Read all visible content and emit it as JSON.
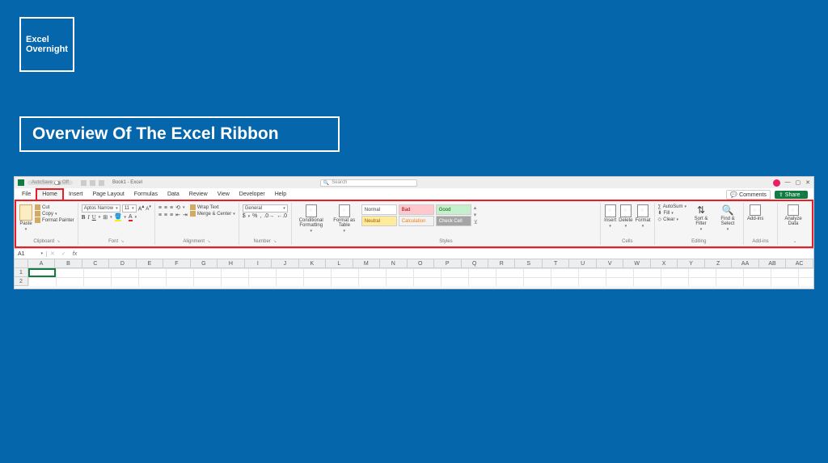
{
  "brand": {
    "line1": "Excel",
    "line2": "Overnight"
  },
  "slide_title": "Overview Of The Excel Ribbon",
  "titlebar": {
    "autosave": "AutoSave",
    "off": "Off",
    "doc": "Book1 - Excel",
    "search_ph": "Search"
  },
  "tabs": [
    "File",
    "Home",
    "Insert",
    "Page Layout",
    "Formulas",
    "Data",
    "Review",
    "View",
    "Developer",
    "Help"
  ],
  "comments": "Comments",
  "share": "Share",
  "clipboard": {
    "paste": "Paste",
    "cut": "Cut",
    "copy": "Copy",
    "painter": "Format Painter",
    "label": "Clipboard"
  },
  "font": {
    "name": "Aptos Narrow",
    "size": "11",
    "label": "Font"
  },
  "alignment": {
    "wrap": "Wrap Text",
    "merge": "Merge & Center",
    "label": "Alignment"
  },
  "number": {
    "format": "General",
    "label": "Number"
  },
  "styles": {
    "cond": "Conditional Formatting",
    "table": "Format as Table",
    "normal": "Normal",
    "bad": "Bad",
    "good": "Good",
    "neutral": "Neutral",
    "calc": "Calculation",
    "check": "Check Cell",
    "label": "Styles"
  },
  "cells": {
    "insert": "Insert",
    "delete": "Delete",
    "format": "Format",
    "label": "Cells"
  },
  "editing": {
    "autosum": "AutoSum",
    "fill": "Fill",
    "clear": "Clear",
    "sort": "Sort & Filter",
    "find": "Find & Select",
    "label": "Editing"
  },
  "addins": {
    "btn": "Add-ins",
    "label": "Add-ins"
  },
  "analyze": {
    "btn": "Analyze Data"
  },
  "cellref": "A1",
  "cols": [
    "A",
    "B",
    "C",
    "D",
    "E",
    "F",
    "G",
    "H",
    "I",
    "J",
    "K",
    "L",
    "M",
    "N",
    "O",
    "P",
    "Q",
    "R",
    "S",
    "T",
    "U",
    "V",
    "W",
    "X",
    "Y",
    "Z",
    "AA",
    "AB",
    "AC"
  ],
  "rows": [
    "1",
    "2"
  ]
}
